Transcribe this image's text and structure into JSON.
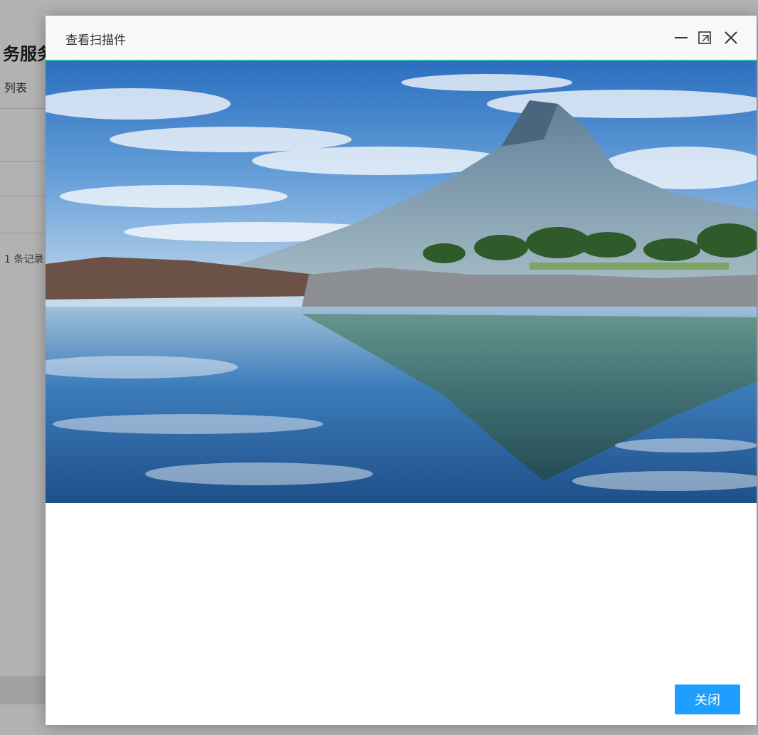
{
  "background": {
    "title_fragment": "务服务",
    "subtitle_fragment": "列表",
    "record_fragment": "1 条记录"
  },
  "modal": {
    "title": "查看扫描件",
    "icons": [
      "minimize-icon",
      "maximize-icon",
      "close-icon"
    ],
    "close_button_label": "关闭",
    "accent_color": "#20b69a",
    "button_color": "#1e9fff"
  },
  "image": {
    "description_icon": "landscape-photo"
  }
}
